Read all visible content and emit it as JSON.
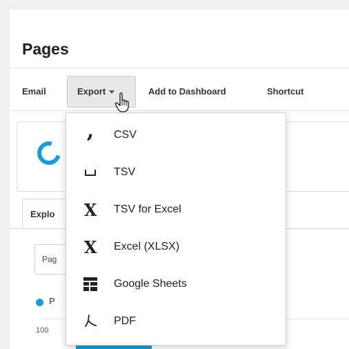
{
  "page": {
    "title": "Pages"
  },
  "toolbar": {
    "email_label": "Email",
    "export_label": "Export",
    "add_to_dashboard_label": "Add to Dashboard",
    "shortcut_label": "Shortcut"
  },
  "export_menu": {
    "items": [
      {
        "label": "CSV",
        "icon": "comma-icon"
      },
      {
        "label": "TSV",
        "icon": "tab-space-icon"
      },
      {
        "label": "TSV for Excel",
        "icon": "excel-x-icon"
      },
      {
        "label": "Excel (XLSX)",
        "icon": "excel-x-icon"
      },
      {
        "label": "Google Sheets",
        "icon": "sheets-grid-icon"
      },
      {
        "label": "PDF",
        "icon": "pdf-icon"
      }
    ]
  },
  "background": {
    "tab_label": "Explo",
    "select_value": "Pag",
    "series_label": "P",
    "axis_tick": "100"
  },
  "colors": {
    "accent": "#1a9ad6",
    "button_bg": "#e8e8e8"
  }
}
